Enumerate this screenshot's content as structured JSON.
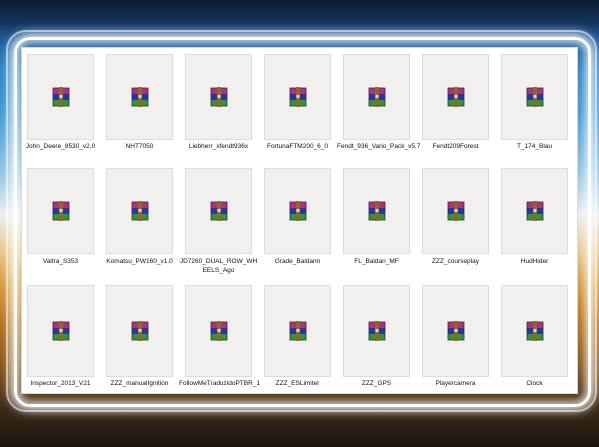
{
  "files": [
    {
      "name": "John_Deere_8530_v2.0",
      "icon": "winrar-archive-icon"
    },
    {
      "name": "NHT7050",
      "icon": "winrar-archive-icon"
    },
    {
      "name": "Liebherr_xfendt936x",
      "icon": "winrar-archive-icon"
    },
    {
      "name": "FortunaFTM200_6_0",
      "icon": "winrar-archive-icon"
    },
    {
      "name": "Fendt_936_Vario_Pack_v5.7",
      "icon": "winrar-archive-icon"
    },
    {
      "name": "Fendt209Forest",
      "icon": "winrar-archive-icon"
    },
    {
      "name": "T_174_Blau",
      "icon": "winrar-archive-icon"
    },
    {
      "name": "Valtra_S353",
      "icon": "winrar-archive-icon"
    },
    {
      "name": "Komatsu_PW160_v1.0",
      "icon": "winrar-archive-icon"
    },
    {
      "name": "JD7260_DUAL_ROW_WHEELS_Ago",
      "icon": "winrar-archive-icon"
    },
    {
      "name": "Grade_Baldann",
      "icon": "winrar-archive-icon"
    },
    {
      "name": "FL_Baldan_MF",
      "icon": "winrar-archive-icon"
    },
    {
      "name": "ZZZ_courseplay",
      "icon": "winrar-archive-icon"
    },
    {
      "name": "HudHider",
      "icon": "winrar-archive-icon"
    },
    {
      "name": "Inspector_2013_V21",
      "icon": "winrar-archive-icon"
    },
    {
      "name": "ZZZ_manualIgnition",
      "icon": "winrar-archive-icon"
    },
    {
      "name": "FollowMeTraduzidoPTBR_1",
      "icon": "winrar-archive-icon"
    },
    {
      "name": "ZZZ_ESLimiter",
      "icon": "winrar-archive-icon"
    },
    {
      "name": "ZZZ_GPS",
      "icon": "winrar-archive-icon"
    },
    {
      "name": "Playercamera",
      "icon": "winrar-archive-icon"
    },
    {
      "name": "Clock",
      "icon": "winrar-archive-icon"
    }
  ],
  "colors": {
    "tile_background": "#f1f0ef",
    "panel_background": "#ffffff",
    "rar_magenta": "#b0307a",
    "rar_blue": "#2436a8",
    "rar_green": "#2e9a2e",
    "rar_strap": "#8a6a2a"
  }
}
